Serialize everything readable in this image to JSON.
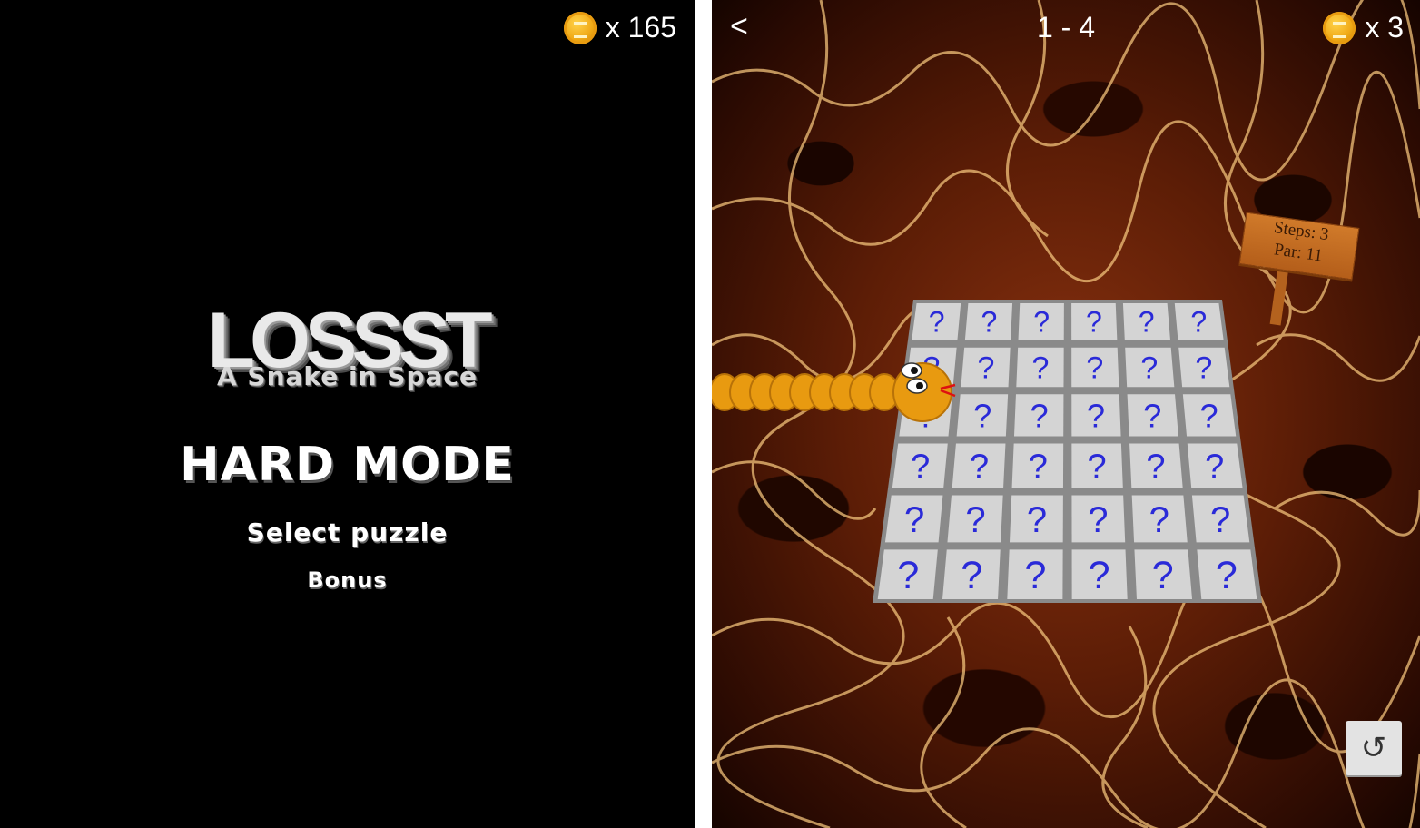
{
  "menu_screen": {
    "coin_count": "x 165",
    "logo_title": "LOSSST",
    "logo_subtitle": "A Snake in Space",
    "mode_title": "HARD MODE",
    "items": [
      "Select puzzle",
      "Bonus"
    ]
  },
  "game_screen": {
    "back_label": "<",
    "level": "1 - 4",
    "coin_count": "x 3",
    "sign": {
      "steps": "Steps: 3",
      "par": "Par: 11"
    },
    "tile_symbol": "?",
    "grid": {
      "rows": 6,
      "cols": 6
    },
    "undo_label": "↺"
  },
  "colors": {
    "coin": "#f0a915",
    "tile": "#d4d4d4",
    "tile_symbol": "#2a2ad8",
    "snake": "#e89a10",
    "lava_veins": "#f2c27a"
  }
}
